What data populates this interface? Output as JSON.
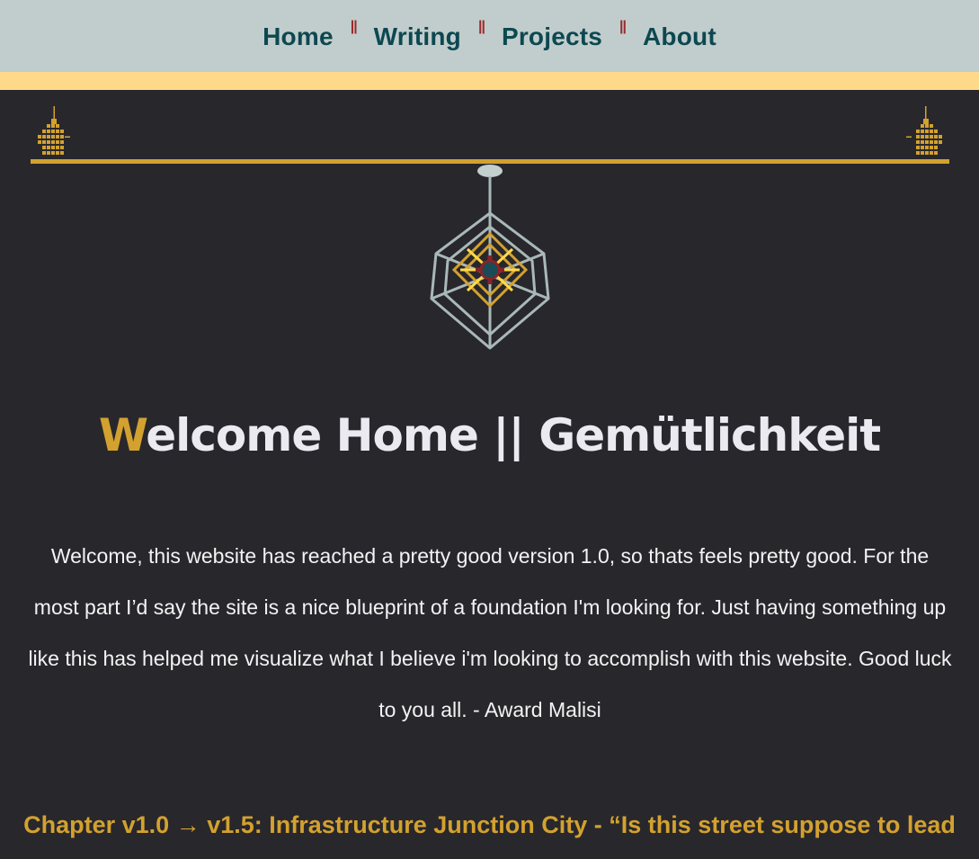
{
  "nav": {
    "items": [
      {
        "label": "Home"
      },
      {
        "label": "Writing"
      },
      {
        "label": "Projects"
      },
      {
        "label": "About"
      }
    ],
    "separator": "||"
  },
  "hero": {
    "title_first_letter": "W",
    "title_rest": "elcome Home || Gemütlichkeit",
    "intro": "Welcome, this website has reached a pretty good version 1.0, so thats feels pretty good. For the most part I’d say the site is a nice blueprint of a foundation I'm looking for. Just having something up like this has helped me visualize what I believe i'm looking to accomplish with this website. Good luck to you all. - Award Malisi"
  },
  "chapter": {
    "heading": "Chapter v1.0 → v1.5: Infrastructure Junction City - “Is this street suppose to lead"
  },
  "colors": {
    "nav_bg": "#c1cdcc",
    "nav_text": "#0d4851",
    "separator": "#9b2b2b",
    "ribbon": "#fed98a",
    "page_bg": "#28272c",
    "accent_gold": "#d3a12f",
    "chandelier_frame": "#a9b8b9"
  },
  "icons": {
    "tower": "art-deco-tower-icon",
    "chandelier": "geometric-chandelier-icon"
  }
}
